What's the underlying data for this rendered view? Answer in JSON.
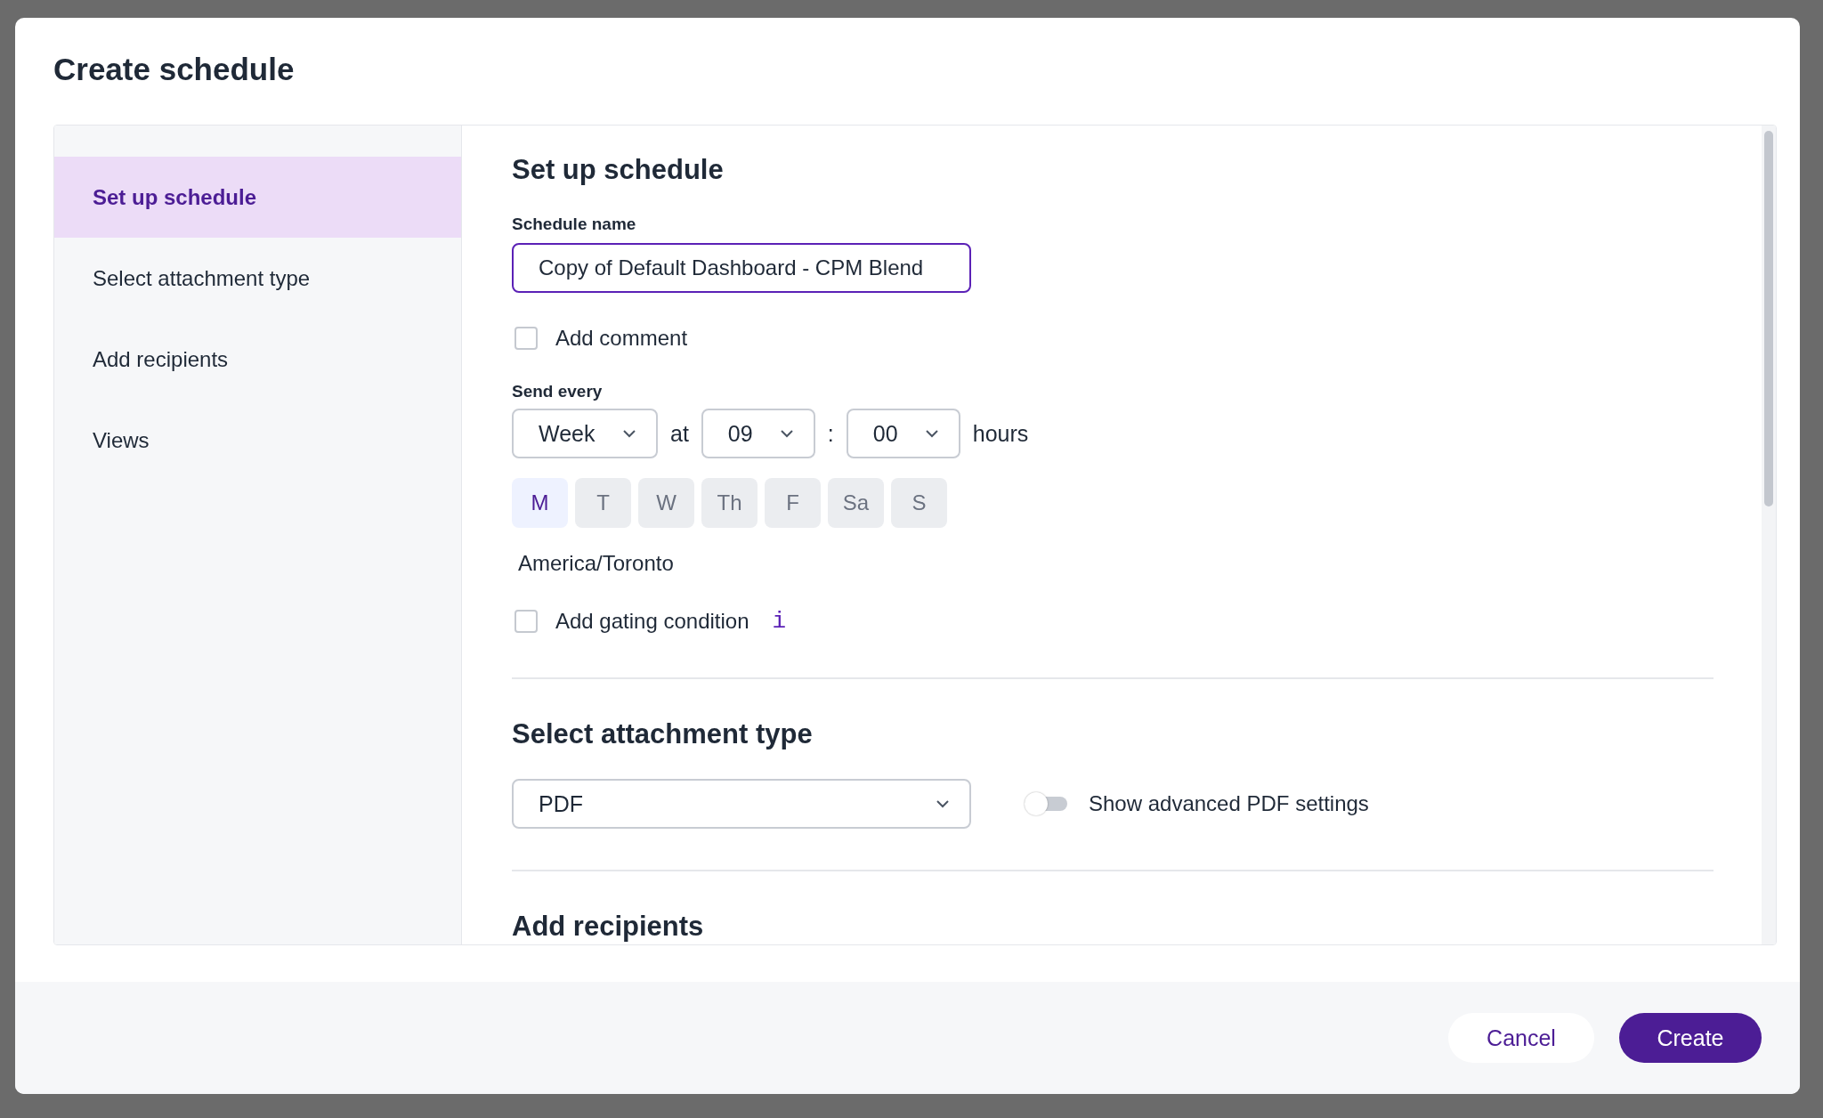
{
  "dialog": {
    "title": "Create schedule"
  },
  "sidebar": {
    "items": [
      {
        "label": "Set up schedule",
        "selected": true
      },
      {
        "label": "Select attachment type",
        "selected": false
      },
      {
        "label": "Add recipients",
        "selected": false
      },
      {
        "label": "Views",
        "selected": false
      }
    ]
  },
  "setup": {
    "heading": "Set up schedule",
    "name_label": "Schedule name",
    "name_value": "Copy of Default Dashboard - CPM Blend",
    "comment": {
      "label": "Add comment",
      "checked": false
    },
    "send_every_label": "Send every",
    "period": "Week",
    "at": "at",
    "hour": "09",
    "colon": ":",
    "minute": "00",
    "hours": "hours",
    "days": [
      {
        "label": "M",
        "selected": true
      },
      {
        "label": "T",
        "selected": false
      },
      {
        "label": "W",
        "selected": false
      },
      {
        "label": "Th",
        "selected": false
      },
      {
        "label": "F",
        "selected": false
      },
      {
        "label": "Sa",
        "selected": false
      },
      {
        "label": "S",
        "selected": false
      }
    ],
    "timezone": "America/Toronto",
    "gating": {
      "label": "Add gating condition",
      "checked": false
    },
    "info": "i"
  },
  "attachment": {
    "heading": "Select attachment type",
    "type": "PDF",
    "advanced": {
      "label": "Show advanced PDF settings",
      "on": false
    }
  },
  "recipients": {
    "heading": "Add recipients"
  },
  "footer": {
    "cancel": "Cancel",
    "create": "Create"
  }
}
